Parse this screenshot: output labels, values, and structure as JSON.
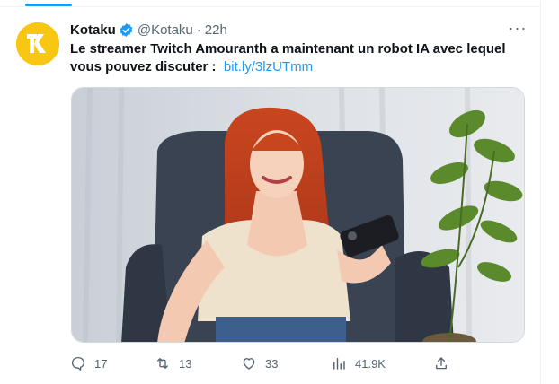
{
  "tweet": {
    "author_name": "Kotaku",
    "handle": "@Kotaku",
    "separator": "·",
    "time": "22h",
    "text": "Le streamer Twitch Amouranth a maintenant un robot IA avec lequel vous pouvez discuter :",
    "link": "bit.ly/3lzUTmm",
    "more_label": "···"
  },
  "actions": {
    "replies": "17",
    "retweets": "13",
    "likes": "33",
    "views": "41.9K"
  },
  "colors": {
    "accent": "#1d9bf0",
    "avatar_bg": "#f7c713",
    "muted_text": "#536471"
  },
  "icons": [
    "verified-badge-icon",
    "more-icon",
    "reply-icon",
    "retweet-icon",
    "like-icon",
    "views-icon",
    "share-icon"
  ]
}
